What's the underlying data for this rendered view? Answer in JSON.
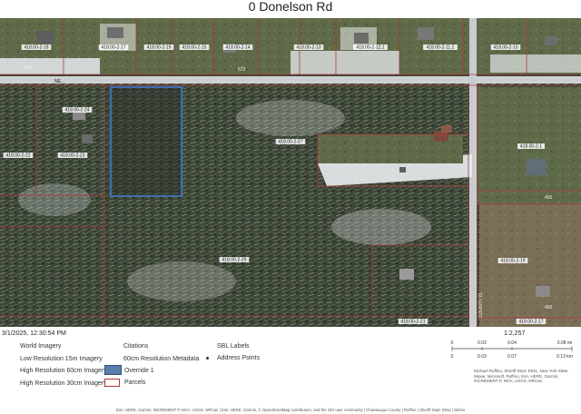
{
  "title": "0 Donelson Rd",
  "timestamp": "3/1/2025, 12:30:54 PM",
  "map": {
    "parcel_labels": [
      "418.00-2-18",
      "418.00-2-17",
      "418.00-2-16",
      "418.00-2-15",
      "418.00-2-14",
      "418.00-2-13",
      "418.00-2-12.1",
      "418.00-2-11.2",
      "418.00-2-10",
      "418.00-2-24",
      "418.00-2-23",
      "418.00-2-22",
      "418.00-2-27",
      "418.00-2-1",
      "418.00-2-19",
      "418.00-2-29",
      "418.00-2-21",
      "418.00-2-17"
    ],
    "address_numbers": [
      "534",
      "572",
      "400",
      "400"
    ],
    "road_labels": [
      "COUNTY 21",
      "NE..."
    ]
  },
  "legend": {
    "col1": [
      "World Imagery",
      "Low Resolution 15m Imagery",
      "High Resolution 60cm Imagery",
      "High Resolution 30cm Imagery"
    ],
    "col2": [
      "Citations",
      "60cm Resolution Metadata",
      "Override 1",
      "Parcels"
    ],
    "col3": [
      "SBL Labels",
      "Address Points"
    ]
  },
  "scale": {
    "ratio": "1:2,257",
    "top_ticks": [
      "0",
      "0.02",
      "0.04",
      "0.08 mi"
    ],
    "bottom_ticks": [
      "0",
      "0.03",
      "0.07",
      "0.13 km"
    ]
  },
  "credits": "Michael Ruffino, Sheriff Dept- E911, New York State, Maxar, Microsoft, Ruffino, Esri, HERE, Garmin, INCREMENT P, NGA, USGS, NRCan",
  "footer": "Esri, HERE, Garmin, INCREMENT P, NGA, USGS, NRCan | Esri, HERE, Garmin, © OpenStreetMap contributors, and the GIS user community | Chautauqua County | Ruffino | Sheriff Dept- E911 | Micha",
  "colors": {
    "override": "#5b7ea8",
    "parcel_line": "#b03a3a"
  }
}
